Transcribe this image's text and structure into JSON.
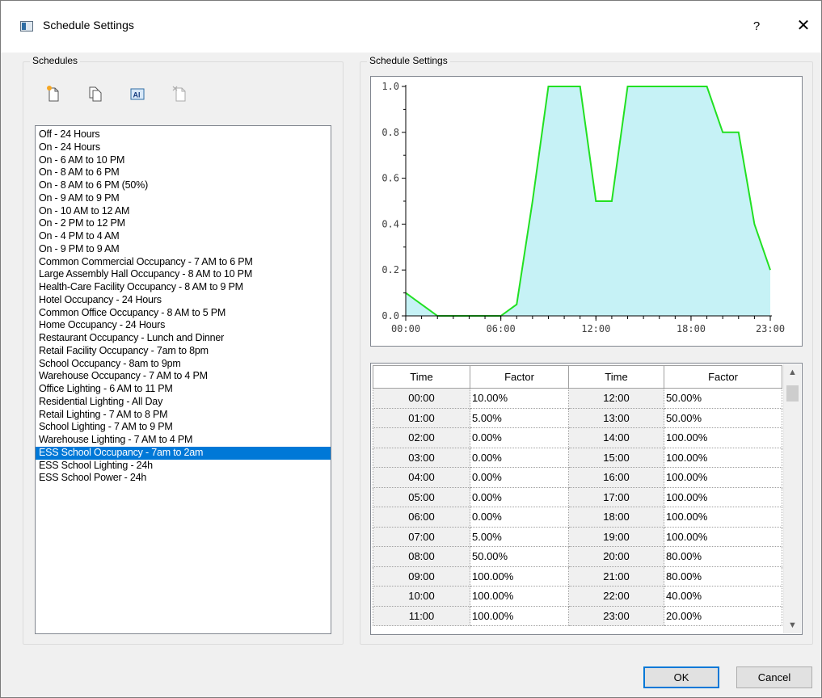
{
  "window": {
    "title": "Schedule Settings",
    "help_label": "?",
    "close_label": "✕"
  },
  "schedules_group": {
    "label": "Schedules"
  },
  "settings_group": {
    "label": "Schedule Settings"
  },
  "toolbar": [
    {
      "name": "new-schedule-icon"
    },
    {
      "name": "copy-schedule-icon"
    },
    {
      "name": "rename-schedule-icon"
    },
    {
      "name": "delete-schedule-icon"
    }
  ],
  "schedules": {
    "items": [
      "Off - 24 Hours",
      "On - 24 Hours",
      "On - 6 AM to 10 PM",
      "On - 8 AM to 6 PM",
      "On - 8 AM to 6 PM (50%)",
      "On - 9 AM to 9 PM",
      "On - 10 AM to 12 AM",
      "On - 2 PM to 12 PM",
      "On - 4 PM to 4 AM",
      "On - 9 PM to 9 AM",
      "Common Commercial Occupancy - 7 AM to 6 PM",
      "Large Assembly Hall Occupancy - 8 AM to 10 PM",
      "Health-Care Facility Occupancy - 8 AM to 9 PM",
      "Hotel Occupancy - 24 Hours",
      "Common Office Occupancy - 8 AM to 5 PM",
      "Home Occupancy - 24 Hours",
      "Restaurant Occupancy - Lunch and Dinner",
      "Retail Facility Occupancy - 7am to 8pm",
      "School Occupancy - 8am to 9pm",
      "Warehouse Occupancy - 7 AM to 4 PM",
      "Office Lighting - 6 AM to 11 PM",
      "Residential Lighting - All Day",
      "Retail Lighting - 7 AM to 8 PM",
      "School Lighting - 7 AM to 9 PM",
      "Warehouse Lighting - 7 AM to 4 PM",
      "ESS School Occupancy - 7am to 2am",
      "ESS School Lighting - 24h",
      "ESS School Power - 24h"
    ],
    "selected_index": 25
  },
  "chart_data": {
    "type": "area",
    "x": [
      0,
      1,
      2,
      3,
      4,
      5,
      6,
      7,
      8,
      9,
      10,
      11,
      12,
      13,
      14,
      15,
      16,
      17,
      18,
      19,
      20,
      21,
      22,
      23
    ],
    "series": [
      {
        "values": [
          0.1,
          0.05,
          0.0,
          0.0,
          0.0,
          0.0,
          0.0,
          0.05,
          0.5,
          1.0,
          1.0,
          1.0,
          0.5,
          0.5,
          1.0,
          1.0,
          1.0,
          1.0,
          1.0,
          1.0,
          0.8,
          0.8,
          0.4,
          0.2
        ]
      }
    ],
    "xlim": [
      0,
      23
    ],
    "ylim": [
      0,
      1.0
    ],
    "x_tick_labels": [
      {
        "x": 0,
        "label": "00:00"
      },
      {
        "x": 6,
        "label": "06:00"
      },
      {
        "x": 12,
        "label": "12:00"
      },
      {
        "x": 18,
        "label": "18:00"
      },
      {
        "x": 23,
        "label": "23:00"
      }
    ],
    "y_ticks": [
      0.0,
      0.2,
      0.4,
      0.6,
      0.8,
      1.0
    ],
    "y_tick_labels": [
      "0.0",
      "0.2",
      "0.4",
      "0.6",
      "0.8",
      "1.0"
    ],
    "line_color": "#22e022",
    "fill_color": "#c6f2f6",
    "grid": false
  },
  "table": {
    "headers": [
      "Time",
      "Factor",
      "Time",
      "Factor"
    ],
    "rows": [
      [
        "00:00",
        "10.00%",
        "12:00",
        "50.00%"
      ],
      [
        "01:00",
        "5.00%",
        "13:00",
        "50.00%"
      ],
      [
        "02:00",
        "0.00%",
        "14:00",
        "100.00%"
      ],
      [
        "03:00",
        "0.00%",
        "15:00",
        "100.00%"
      ],
      [
        "04:00",
        "0.00%",
        "16:00",
        "100.00%"
      ],
      [
        "05:00",
        "0.00%",
        "17:00",
        "100.00%"
      ],
      [
        "06:00",
        "0.00%",
        "18:00",
        "100.00%"
      ],
      [
        "07:00",
        "5.00%",
        "19:00",
        "100.00%"
      ],
      [
        "08:00",
        "50.00%",
        "20:00",
        "80.00%"
      ],
      [
        "09:00",
        "100.00%",
        "21:00",
        "80.00%"
      ],
      [
        "10:00",
        "100.00%",
        "22:00",
        "40.00%"
      ],
      [
        "11:00",
        "100.00%",
        "23:00",
        "20.00%"
      ]
    ]
  },
  "scroll": {
    "up_label": "▲",
    "down_label": "▼"
  },
  "buttons": {
    "ok": "OK",
    "cancel": "Cancel"
  },
  "colors": {
    "selection": "#0078d7",
    "default_button_border": "#0078d7"
  }
}
